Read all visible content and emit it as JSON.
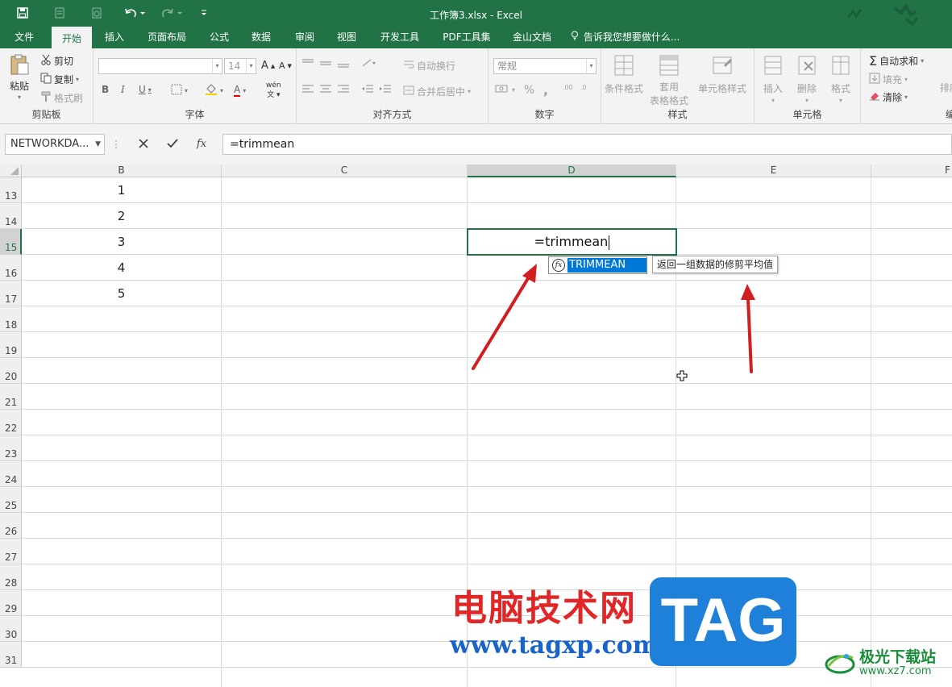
{
  "window": {
    "title": "工作簿3.xlsx - Excel"
  },
  "tabs": [
    "文件",
    "开始",
    "插入",
    "页面布局",
    "公式",
    "数据",
    "审阅",
    "视图",
    "开发工具",
    "PDF工具集",
    "金山文档"
  ],
  "active_tab": "开始",
  "tell_me": "告诉我您想要做什么...",
  "clipboard": {
    "paste": "粘贴",
    "cut": "剪切",
    "copy": "复制",
    "format_painter": "格式刷",
    "label": "剪贴板"
  },
  "font": {
    "name": "",
    "size": "14",
    "bold": "B",
    "italic": "I",
    "underline": "U",
    "grow": "A",
    "shrink": "A",
    "color": "A",
    "wen": "wén",
    "label": "字体"
  },
  "alignment": {
    "wrap": "自动换行",
    "merge": "合并后居中",
    "label": "对齐方式"
  },
  "number": {
    "format": "常规",
    "percent": "%",
    "comma": ",",
    "inc": ".00",
    "dec": ".0",
    "label": "数字"
  },
  "styles": {
    "conditional": "条件格式",
    "table1": "套用",
    "table2": "表格格式",
    "cell_styles": "单元格样式",
    "label": "样式"
  },
  "cells": {
    "insert": "插入",
    "delete": "删除",
    "format": "格式",
    "label": "单元格"
  },
  "editing": {
    "autosum": "自动求和",
    "fill": "填充",
    "clear": "清除",
    "sort": "排序",
    "label": "编"
  },
  "formula_bar": {
    "name_box": "NETWORKDA...",
    "formula": "=trimmean",
    "fx": "fx"
  },
  "columns": [
    {
      "label": "B"
    },
    {
      "label": "C"
    },
    {
      "label": "D"
    },
    {
      "label": "E"
    },
    {
      "label": "F"
    }
  ],
  "rows": [
    "13",
    "14",
    "15",
    "16",
    "17",
    "18",
    "19",
    "20",
    "21",
    "22",
    "23",
    "24",
    "25",
    "26",
    "27",
    "28",
    "29",
    "30",
    "31"
  ],
  "cells_values": {
    "b13": "1",
    "b14": "2",
    "b15": "3",
    "b16": "4",
    "b17": "5"
  },
  "active_cell": {
    "ref": "D15",
    "text": "=trimmean"
  },
  "autocomplete": {
    "item": "TRIMMEAN",
    "fx_glyph": "fx"
  },
  "tooltip": "返回一组数据的修剪平均值",
  "watermark": {
    "cn": "电脑技术网",
    "url": "www.tagxp.com",
    "tag": "TAG",
    "site_cn": "极光下载站",
    "site_url": "www.xz7.com"
  },
  "colors": {
    "excel_green": "#217346",
    "arrow_red": "#d11f1f",
    "selection_blue": "#0078d7"
  }
}
